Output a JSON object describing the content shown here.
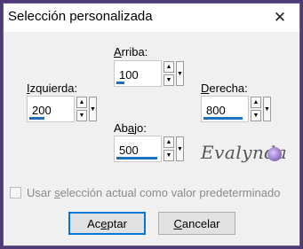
{
  "window": {
    "title": "Selección personalizada"
  },
  "fields": {
    "arriba": {
      "label_pre": "",
      "label_u": "A",
      "label_post": "rriba:",
      "value": "100",
      "bar_fill": 0.18
    },
    "izquierda": {
      "label_pre": "",
      "label_u": "I",
      "label_post": "zquierda:",
      "value": "200",
      "bar_fill": 0.35
    },
    "derecha": {
      "label_pre": "",
      "label_u": "D",
      "label_post": "erecha:",
      "value": "800",
      "bar_fill": 0.92
    },
    "abajo": {
      "label_pre": "Ab",
      "label_u": "a",
      "label_post": "jo:",
      "value": "500",
      "bar_fill": 0.96
    }
  },
  "logo_text": "Evalynda",
  "checkbox": {
    "label_pre": "Usar ",
    "label_u": "s",
    "label_post": "elección actual como valor predeterminado",
    "checked": false
  },
  "buttons": {
    "accept_pre": "Ac",
    "accept_u": "e",
    "accept_post": "ptar",
    "cancel_pre": "",
    "cancel_u": "C",
    "cancel_post": "ancelar"
  },
  "colors": {
    "accent": "#1f6fbf",
    "background": "#f0f0f0",
    "frame": "#4f3b78"
  }
}
